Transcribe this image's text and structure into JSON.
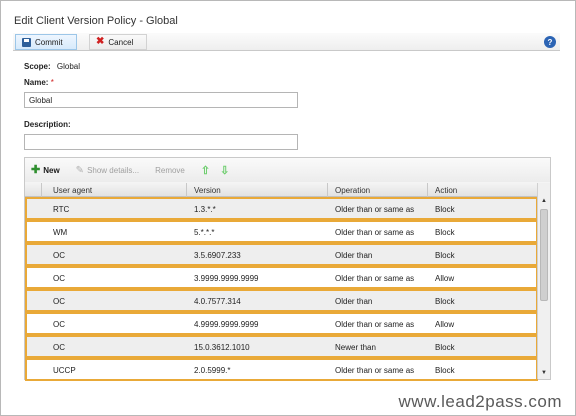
{
  "window": {
    "title": "Edit Client Version Policy - Global"
  },
  "toolbar": {
    "commit_label": "Commit",
    "cancel_label": "Cancel"
  },
  "form": {
    "scope_label": "Scope:",
    "scope_value": "Global",
    "name_label": "Name:",
    "name_value": "Global",
    "description_label": "Description:",
    "description_value": ""
  },
  "grid_toolbar": {
    "new_label": "New",
    "show_details_label": "Show details...",
    "remove_label": "Remove"
  },
  "table": {
    "columns": [
      "User agent",
      "Version",
      "Operation",
      "Action"
    ],
    "rows": [
      {
        "agent": "RTC",
        "version": "1.3.*.*",
        "operation": "Older than or same as",
        "action": "Block"
      },
      {
        "agent": "WM",
        "version": "5.*.*.*",
        "operation": "Older than or same as",
        "action": "Block"
      },
      {
        "agent": "OC",
        "version": "3.5.6907.233",
        "operation": "Older than",
        "action": "Block"
      },
      {
        "agent": "OC",
        "version": "3.9999.9999.9999",
        "operation": "Older than or same as",
        "action": "Allow"
      },
      {
        "agent": "OC",
        "version": "4.0.7577.314",
        "operation": "Older than",
        "action": "Block"
      },
      {
        "agent": "OC",
        "version": "4.9999.9999.9999",
        "operation": "Older than or same as",
        "action": "Allow"
      },
      {
        "agent": "OC",
        "version": "15.0.3612.1010",
        "operation": "Newer than",
        "action": "Block"
      },
      {
        "agent": "UCCP",
        "version": "2.0.5999.*",
        "operation": "Older than or same as",
        "action": "Block"
      }
    ]
  },
  "watermark": "www.lead2pass.com",
  "colors": {
    "row_highlight": "#e9a938",
    "accent": "#2c64b4"
  }
}
